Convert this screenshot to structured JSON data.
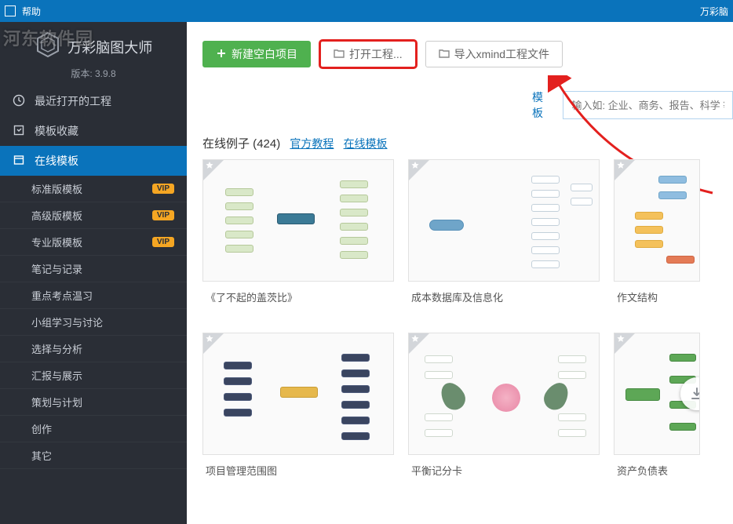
{
  "titlebar": {
    "help": "帮助",
    "brand_right": "万彩脑"
  },
  "logo": {
    "watermark": "河东软件园",
    "app_name": "万彩脑图大师",
    "version": "版本: 3.9.8"
  },
  "sidebar": {
    "recent": "最近打开的工程",
    "favorites": "模板收藏",
    "online": "在线模板",
    "subitems": [
      {
        "label": "标准版模板",
        "vip": true
      },
      {
        "label": "高级版模板",
        "vip": true
      },
      {
        "label": "专业版模板",
        "vip": true
      },
      {
        "label": "笔记与记录",
        "vip": false
      },
      {
        "label": "重点考点温习",
        "vip": false
      },
      {
        "label": "小组学习与讨论",
        "vip": false
      },
      {
        "label": "选择与分析",
        "vip": false
      },
      {
        "label": "汇报与展示",
        "vip": false
      },
      {
        "label": "策划与计划",
        "vip": false
      },
      {
        "label": "创作",
        "vip": false
      },
      {
        "label": "其它",
        "vip": false
      }
    ],
    "vip_label": "VIP"
  },
  "toolbar": {
    "new_blank": "新建空白项目",
    "open_project": "打开工程...",
    "import_xmind": "导入xmind工程文件"
  },
  "search": {
    "label": "模板",
    "placeholder": "输入如: 企业、商务、报告、科学 等关键"
  },
  "examples": {
    "heading_prefix": "在线例子",
    "count": "424",
    "link_tutorial": "官方教程",
    "link_online": "在线模板"
  },
  "cards": [
    {
      "title": "《了不起的盖茨比》"
    },
    {
      "title": "成本数据库及信息化"
    },
    {
      "title": "作文结构"
    },
    {
      "title": "项目管理范围图"
    },
    {
      "title": "平衡记分卡"
    },
    {
      "title": "资产负债表"
    }
  ]
}
